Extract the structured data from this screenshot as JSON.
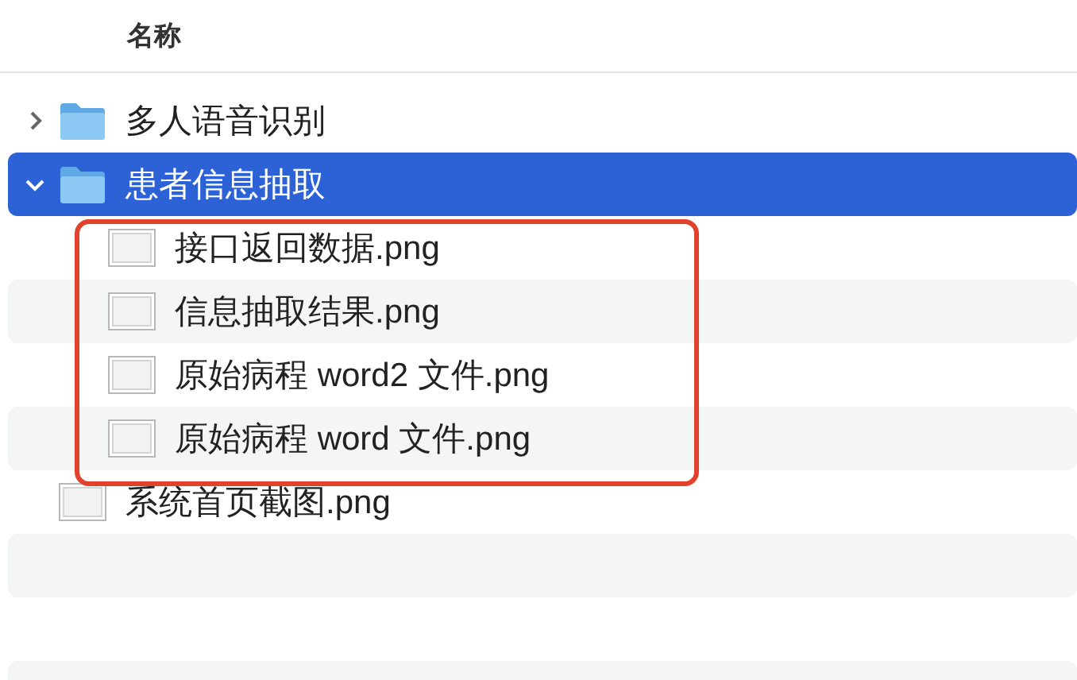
{
  "header": {
    "name_column": "名称"
  },
  "items": [
    {
      "kind": "folder",
      "name": "多人语音识别",
      "expanded": false,
      "selected": false,
      "highlighted": false
    },
    {
      "kind": "folder",
      "name": "患者信息抽取",
      "expanded": true,
      "selected": true,
      "highlighted": false,
      "children": [
        {
          "kind": "file",
          "name": "接口返回数据.png",
          "selected": false,
          "highlighted": true
        },
        {
          "kind": "file",
          "name": "信息抽取结果.png",
          "selected": false,
          "highlighted": true
        },
        {
          "kind": "file",
          "name": "原始病程 word2 文件.png",
          "selected": false,
          "highlighted": true
        },
        {
          "kind": "file",
          "name": "原始病程 word 文件.png",
          "selected": false,
          "highlighted": true
        }
      ]
    },
    {
      "kind": "file",
      "name": "系统首页截图.png",
      "selected": false,
      "highlighted": false
    }
  ]
}
